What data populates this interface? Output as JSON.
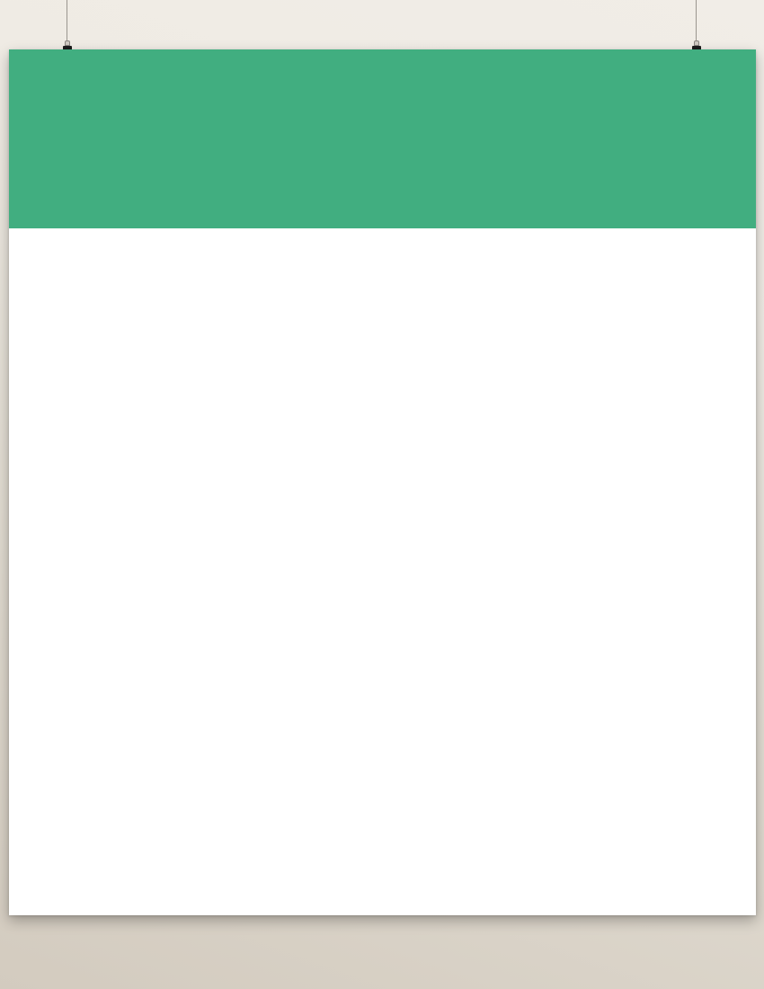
{
  "scene": {
    "description_free": true,
    "colors": {
      "band": "#41ae80",
      "poster": "#ffffff",
      "clip": "#1c1c1c",
      "wire": "#9a958e"
    },
    "icons": {
      "left_hanger": "binder-clip-icon",
      "right_hanger": "binder-clip-icon"
    }
  }
}
